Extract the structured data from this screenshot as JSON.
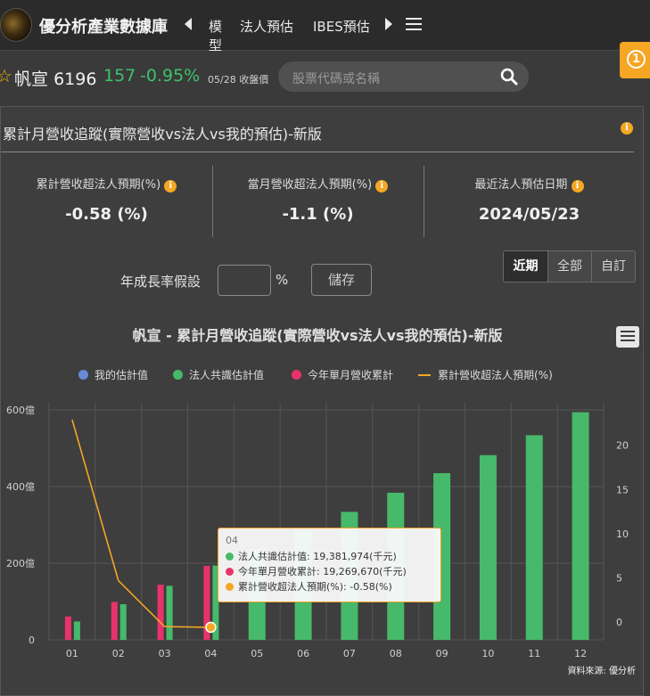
{
  "nav": {
    "brand": "優分析產業數據庫",
    "items": [
      {
        "label": "模型"
      },
      {
        "label": "法人預估"
      },
      {
        "label": "IBES預估"
      }
    ]
  },
  "stock": {
    "name": "帆宣",
    "code": "6196",
    "price": "157",
    "change": "-0.95%",
    "date": "05/28 收盤價",
    "search_placeholder": "股票代碼或名稱"
  },
  "notification_count": "1",
  "panel": {
    "title": "累計月營收追蹤(實際營收vs法人vs我的預估)-新版",
    "stats": [
      {
        "label": "累計營收超法人預期(%)",
        "value": "-0.58 (%)"
      },
      {
        "label": "當月營收超法人預期(%)",
        "value": "-1.1 (%)"
      },
      {
        "label": "最近法人預估日期",
        "value": "2024/05/23"
      }
    ],
    "growth_label": "年成長率假設",
    "growth_unit": "%",
    "save_label": "儲存",
    "range_tabs": [
      "近期",
      "全部",
      "自訂"
    ]
  },
  "colors": {
    "my_estimate": "#6a8ad8",
    "consensus": "#47b96b",
    "actual": "#e8336a",
    "surprise_line": "#f5a623"
  },
  "legend": {
    "my_estimate": "我的估計值",
    "consensus": "法人共識估計值",
    "actual": "今年單月營收累計",
    "surprise": "累計營收超法人預期(%)"
  },
  "tooltip": {
    "header": "04",
    "rows": [
      {
        "label": "法人共識估計值: 19,381,974(千元)"
      },
      {
        "label": "今年單月營收累計: 19,269,670(千元)"
      },
      {
        "label": "累計營收超法人預期(%): -0.58(%)"
      }
    ]
  },
  "source": "資料來源: 優分析",
  "chart_data": {
    "type": "bar",
    "title": "帆宣 - 累計月營收追蹤(實際營收vs法人vs我的預估)-新版",
    "categories": [
      "01",
      "02",
      "03",
      "04",
      "05",
      "06",
      "07",
      "08",
      "09",
      "10",
      "11",
      "12"
    ],
    "y_left": {
      "ticks": [
        "0",
        "200億",
        "400億",
        "600億"
      ],
      "range": [
        0,
        600
      ]
    },
    "y_right": {
      "ticks": [
        "0",
        "5",
        "10",
        "15",
        "20"
      ],
      "range": [
        -2,
        24
      ]
    },
    "series": [
      {
        "name": "法人共識估計值",
        "kind": "bar",
        "axis": "left",
        "values": [
          48,
          93,
          141,
          194,
          237,
          285,
          334,
          384,
          435,
          482,
          534,
          594
        ]
      },
      {
        "name": "今年單月營收累計",
        "kind": "bar",
        "axis": "left",
        "values": [
          61,
          99,
          144,
          193,
          null,
          null,
          null,
          null,
          null,
          null,
          null,
          null
        ]
      },
      {
        "name": "累計營收超法人預期(%)",
        "kind": "line",
        "axis": "right",
        "values": [
          22.9,
          4.7,
          -0.5,
          -0.58,
          null,
          null,
          null,
          null,
          null,
          null,
          null,
          null
        ]
      }
    ],
    "grid": true,
    "legend_position": "top-center"
  }
}
